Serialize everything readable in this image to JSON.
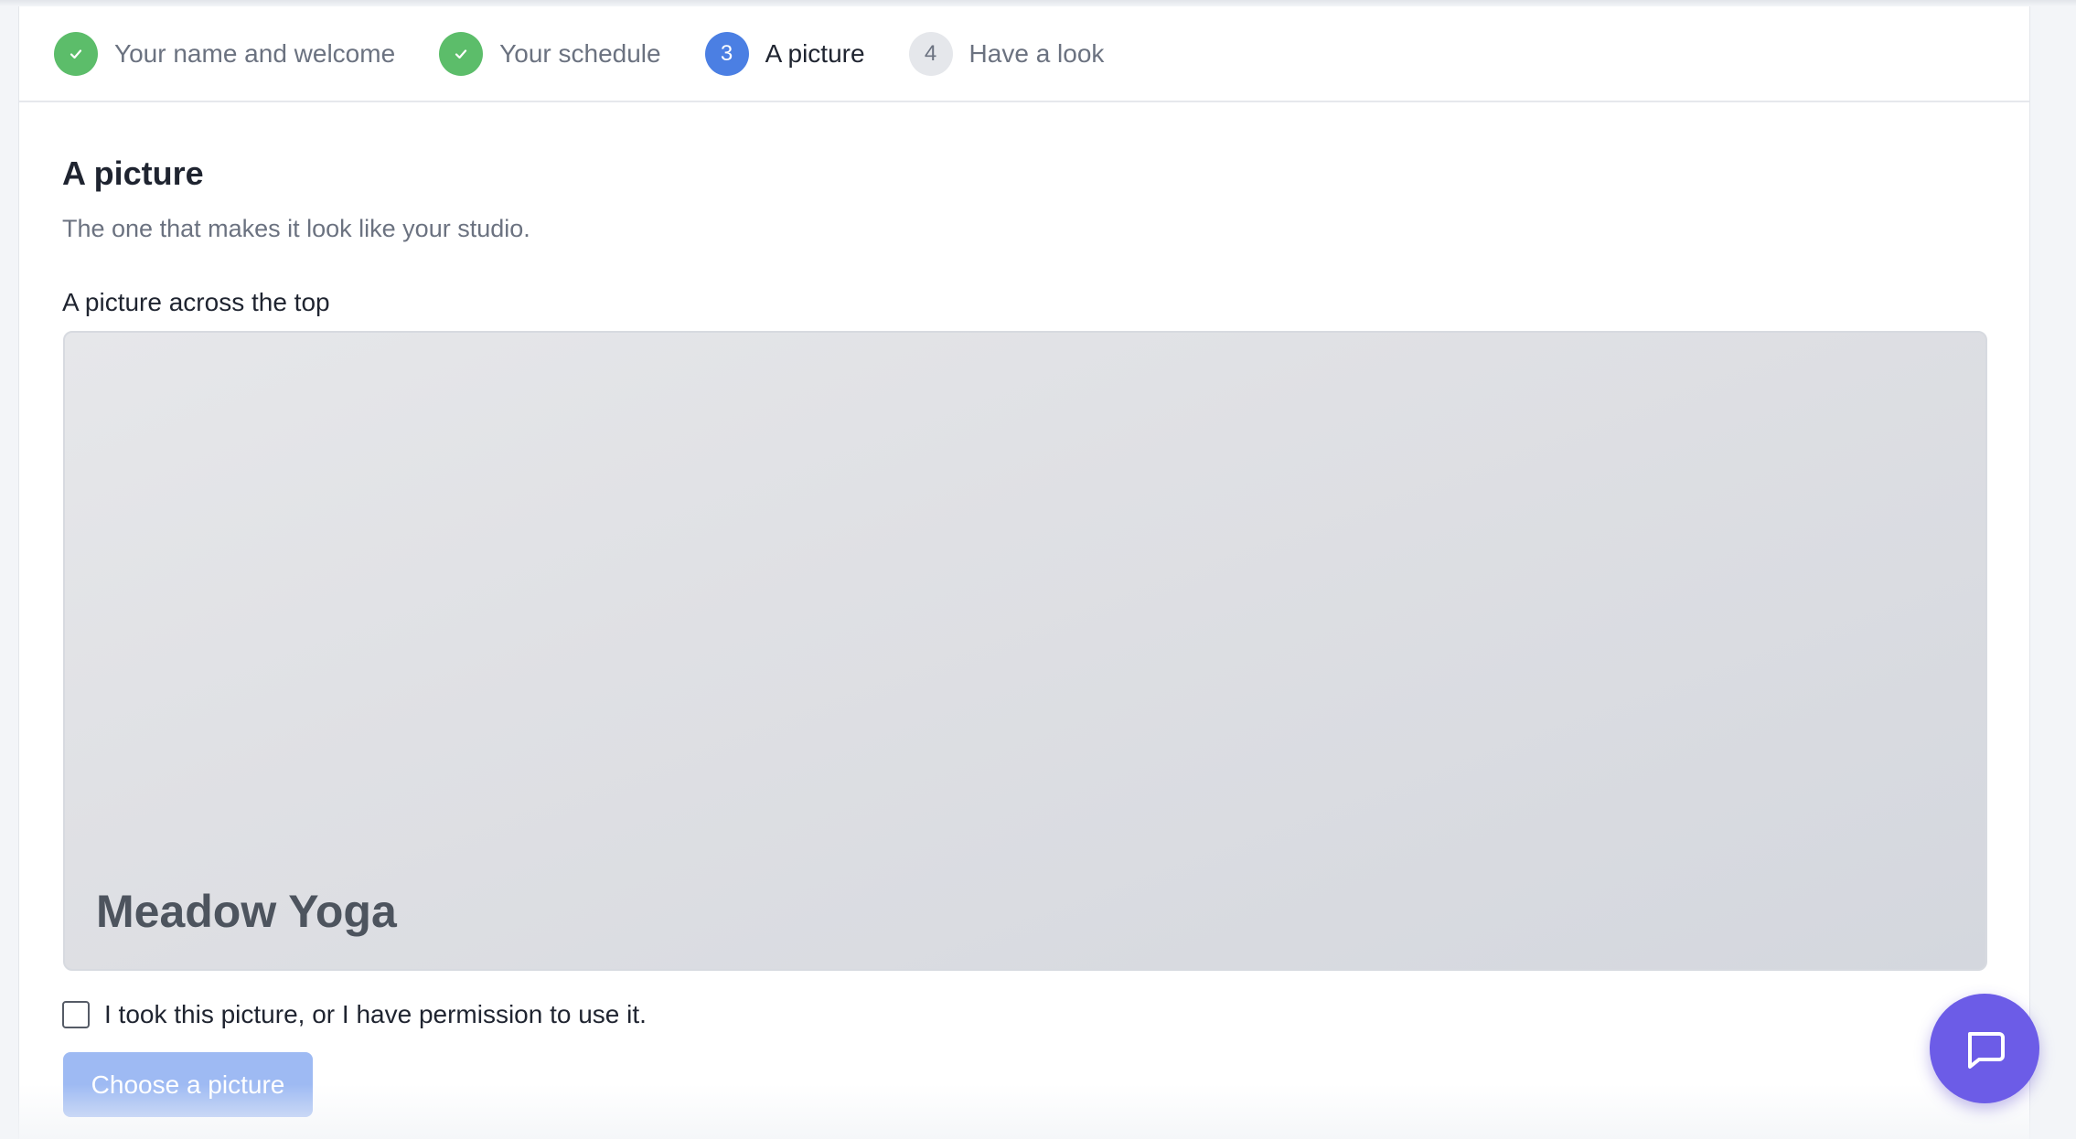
{
  "stepper": {
    "steps": [
      {
        "number": "1",
        "label": "Your name and welcome",
        "state": "done"
      },
      {
        "number": "2",
        "label": "Your schedule",
        "state": "done"
      },
      {
        "number": "3",
        "label": "A picture",
        "state": "current"
      },
      {
        "number": "4",
        "label": "Have a look",
        "state": "todo"
      }
    ]
  },
  "section": {
    "title": "A picture",
    "subtitle": "The one that makes it look like your studio."
  },
  "banner": {
    "field_label": "A picture across the top",
    "studio_name": "Meadow Yoga"
  },
  "permission": {
    "label": "I took this picture, or I have permission to use it.",
    "checked": false
  },
  "actions": {
    "choose_label": "Choose a picture"
  },
  "icons": {
    "step_done": "check-icon",
    "chat": "chat-bubble-icon"
  },
  "colors": {
    "done": "#5cbd6a",
    "current": "#4b7fe3",
    "todo": "#e5e7eb",
    "button_disabled": "#9ebaf3",
    "chat": "#6c5ce7"
  }
}
